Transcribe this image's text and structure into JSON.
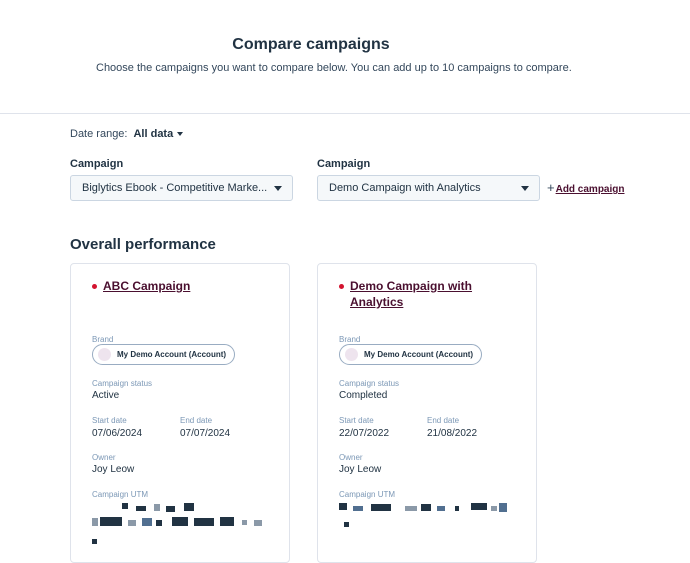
{
  "header": {
    "title": "Compare campaigns",
    "subtitle": "Choose the campaigns you want to compare below. You can add up to 10 campaigns to compare."
  },
  "filters": {
    "date_range_label": "Date range:",
    "date_range_value": "All data"
  },
  "campaign_selects": [
    {
      "label": "Campaign",
      "value": "Biglytics Ebook - Competitive Marke..."
    },
    {
      "label": "Campaign",
      "value": "Demo Campaign with Analytics"
    }
  ],
  "add_campaign_label": "Add campaign",
  "overall_title": "Overall performance",
  "labels": {
    "brand": "Brand",
    "status": "Campaign status",
    "start": "Start date",
    "end": "End date",
    "owner": "Owner",
    "utm": "Campaign UTM"
  },
  "cards": [
    {
      "name": "ABC Campaign",
      "brand": "My Demo Account (Account)",
      "status": "Active",
      "start_date": "07/06/2024",
      "end_date": "07/07/2024",
      "owner": "Joy Leow"
    },
    {
      "name": "Demo Campaign with Analytics",
      "brand": "My Demo Account (Account)",
      "status": "Completed",
      "start_date": "22/07/2022",
      "end_date": "21/08/2022",
      "owner": "Joy Leow"
    }
  ],
  "colors": {
    "accent_link": "#4a0f2f",
    "status_dot": "#d3132f",
    "border": "#dfe3eb"
  },
  "icons": {
    "dropdown": "caret-down-icon",
    "add": "plus-icon"
  }
}
